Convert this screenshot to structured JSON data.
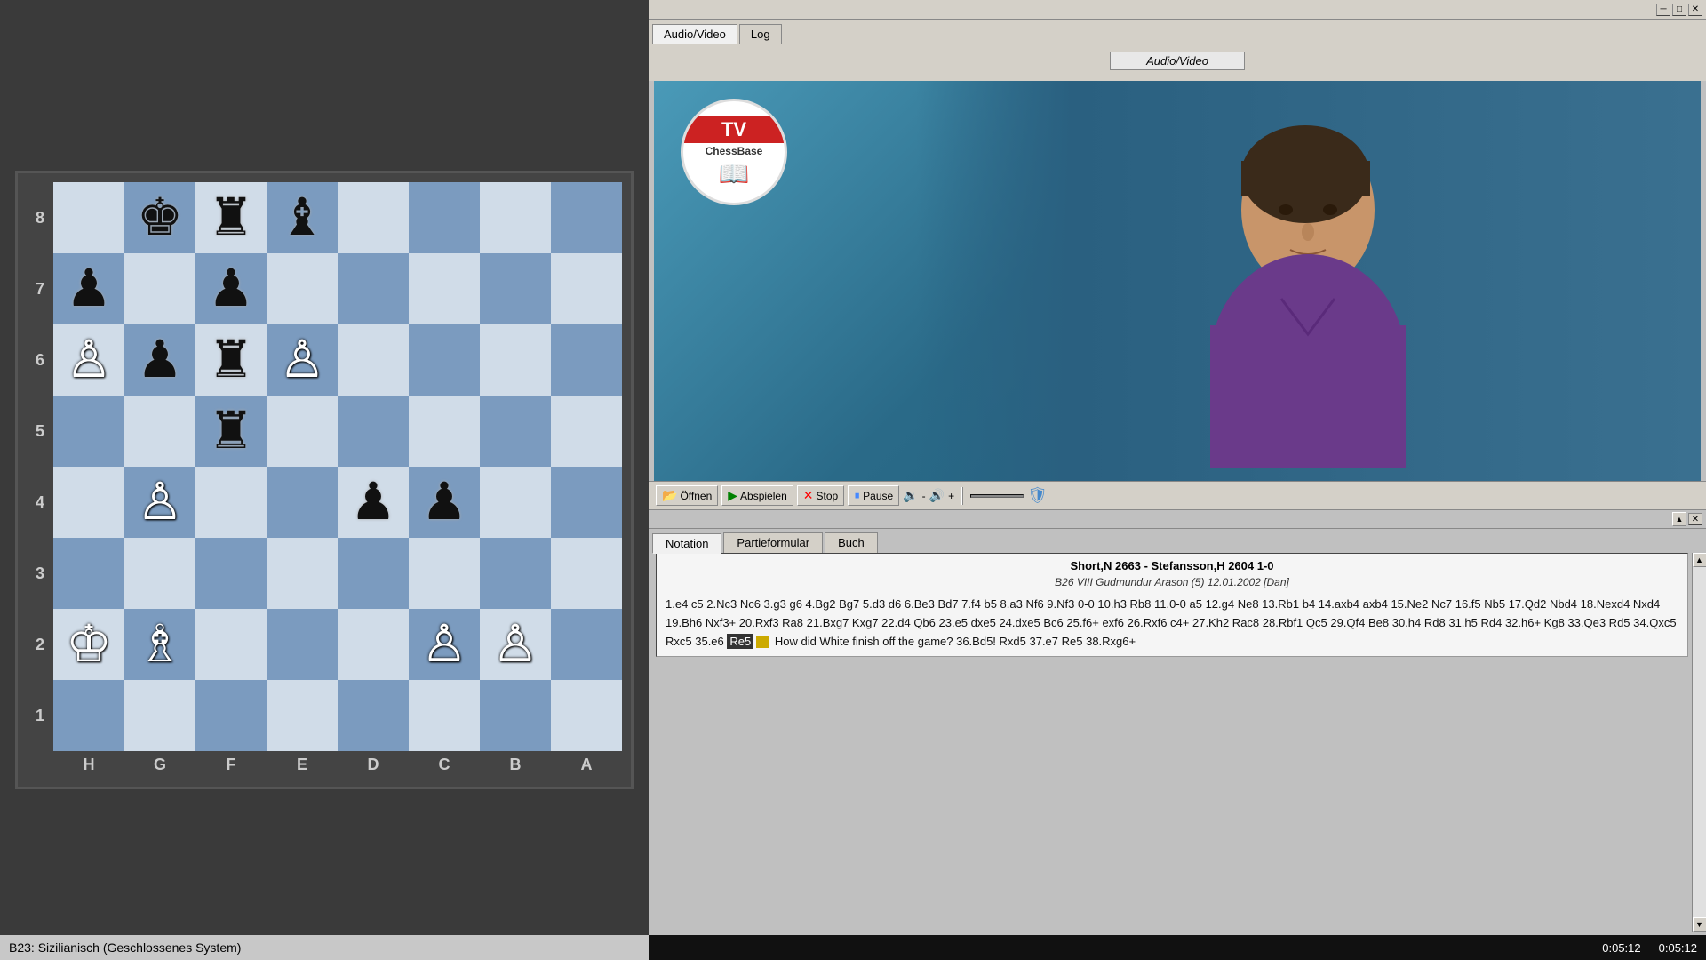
{
  "left": {
    "status": "B23: Sizilianisch (Geschlossenes System)"
  },
  "right": {
    "tabs": [
      {
        "label": "Audio/Video",
        "active": true
      },
      {
        "label": "Log",
        "active": false
      }
    ],
    "av_title": "Audio/Video",
    "controls": {
      "open": "Öffnen",
      "play": "Abspielen",
      "stop": "Stop",
      "pause": "Pause"
    },
    "notation": {
      "tabs": [
        {
          "label": "Notation",
          "active": true
        },
        {
          "label": "Partieformular",
          "active": false
        },
        {
          "label": "Buch",
          "active": false
        }
      ],
      "game_header": "Short,N 2663 - Stefansson,H 2604  1-0",
      "opening": "B26 VIII Gudmundur Arason (5) 12.01.2002 [Dan]",
      "moves": "1.e4 c5 2.Nc3 Nc6 3.g3 g6 4.Bg2 Bg7 5.d3 d6 6.Be3 Bd7 7.f4 b5 8.a3 Nf6 9.Nf3 0-0 10.h3 Rb8 11.0-0 a5 12.g4 Ne8 13.Rb1 b4 14.axb4 axb4 15.Ne2 Nc7 16.f5 Nb5 17.Qd2 Nbd4 18.Nexd4 Nxd4 19.Bh6 Nxf3+ 20.Rxf3 Ra8 21.Bxg7 Kxg7 22.d4 Qb6 23.e5 dxe5 24.dxe5 Bc6 25.f6+ exf6 26.Rxf6 c4+ 27.Kh2 Rac8 28.Rbf1 Qc5 29.Qf4 Be8 30.h4 Rd8 31.h5 Rd4 32.h6+ Kg8 33.Qe3 Rd5 34.Qxc5 Rxc5 35.e6 Re5 How did White finish off the game? 36.Bd5! Rxd5 37.e7 Re5 38.Rxg6+",
      "highlight_move": "Re5"
    },
    "time": {
      "elapsed": "0:05:12",
      "total": "0:05:12"
    }
  },
  "board": {
    "files": [
      "H",
      "G",
      "F",
      "E",
      "D",
      "C",
      "B",
      "A"
    ],
    "ranks": [
      "1",
      "2",
      "3",
      "4",
      "5",
      "6",
      "7",
      "8"
    ],
    "pieces": {
      "h1": "",
      "g1": "",
      "f1": "",
      "e1": "",
      "d1": "",
      "c1": "",
      "b1": "",
      "a1": "",
      "h2": "♔",
      "g2": "♗",
      "f2": "",
      "e2": "",
      "d2": "",
      "c2": "♙",
      "b2": "♙",
      "a2": "",
      "h3": "",
      "g3": "",
      "f3": "",
      "e3": "",
      "d3": "",
      "c3": "",
      "b3": "",
      "a3": "",
      "h4": "",
      "g4": "♙",
      "f4": "",
      "e4": "",
      "d4": "♟",
      "c4": "♟",
      "b4": "",
      "a4": "",
      "h5": "",
      "g5": "",
      "f5": "♜",
      "e5": "",
      "d5": "",
      "c5": "",
      "b5": "",
      "a5": "",
      "h6": "♙",
      "g6": "♟",
      "f6": "♜",
      "e6": "♙",
      "d6": "",
      "c6": "",
      "b6": "",
      "a6": "",
      "h7": "♟",
      "g7": "",
      "f7": "♟",
      "e7": "",
      "d7": "",
      "c7": "",
      "b7": "",
      "a7": "",
      "h8": "",
      "g8": "♚",
      "f8": "♜",
      "e8": "♝",
      "d8": "",
      "c8": "",
      "b8": "",
      "a8": ""
    },
    "pieces_rank1": {
      "h": "",
      "g": "",
      "f": "",
      "e": "",
      "d": "",
      "c": "",
      "b": "",
      "a": ""
    }
  },
  "icons": {
    "minimize": "─",
    "maximize": "□",
    "close": "✕",
    "scroll_up": "▲",
    "scroll_down": "▼",
    "scroll_left": "◄",
    "scroll_right": "►"
  }
}
